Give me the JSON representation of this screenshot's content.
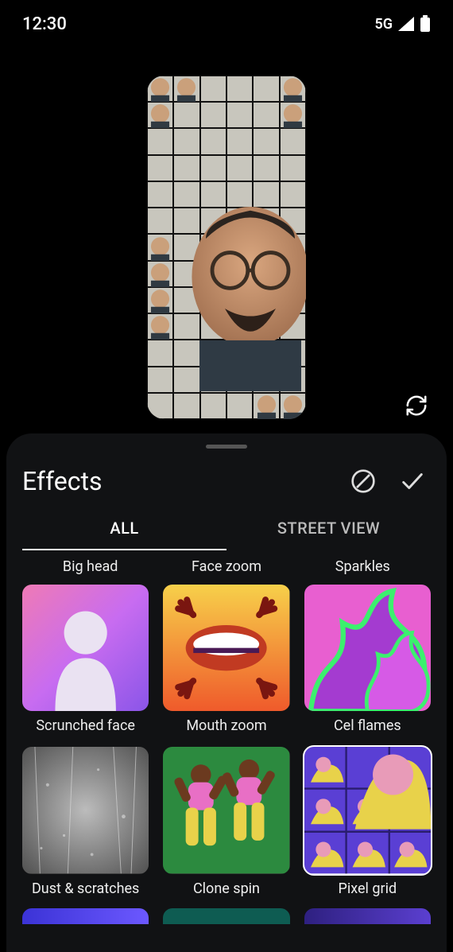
{
  "status": {
    "time": "12:30",
    "network": "5G"
  },
  "icons": {
    "refresh": "refresh-icon",
    "cancel": "cancel-circle-icon",
    "confirm": "check-icon",
    "signal": "signal-icon",
    "battery": "battery-icon"
  },
  "sheet": {
    "title": "Effects",
    "tabs": [
      {
        "label": "ALL",
        "active": true
      },
      {
        "label": "STREET VIEW",
        "active": false
      }
    ],
    "partial_row_above": [
      {
        "label": "Big head"
      },
      {
        "label": "Face zoom"
      },
      {
        "label": "Sparkles"
      }
    ],
    "effects": [
      {
        "id": "scrunched-face",
        "label": "Scrunched face",
        "selected": false
      },
      {
        "id": "mouth-zoom",
        "label": "Mouth zoom",
        "selected": false
      },
      {
        "id": "cel-flames",
        "label": "Cel flames",
        "selected": false
      },
      {
        "id": "dust-scratches",
        "label": "Dust & scratches",
        "selected": false
      },
      {
        "id": "clone-spin",
        "label": "Clone spin",
        "selected": false
      },
      {
        "id": "pixel-grid",
        "label": "Pixel grid",
        "selected": true
      }
    ],
    "peek_colors": [
      "#3b33d6",
      "#0e5c52",
      "#2e2080"
    ]
  },
  "colors": {
    "sheet_bg": "#111214",
    "accent": "#ffffff"
  }
}
